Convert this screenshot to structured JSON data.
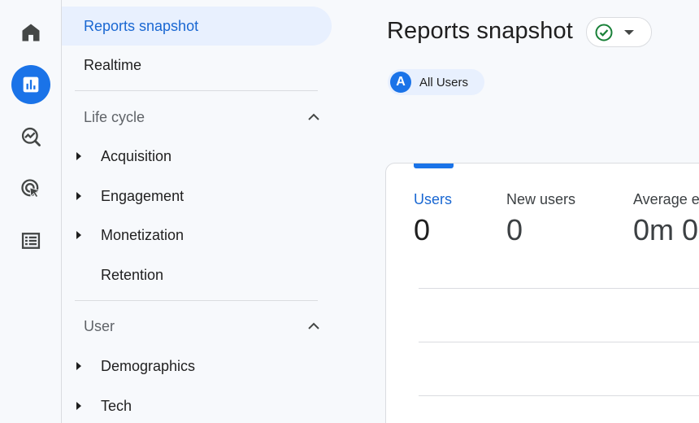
{
  "nav": {
    "top_items": [
      {
        "label": "Reports snapshot",
        "selected": true
      },
      {
        "label": "Realtime",
        "selected": false
      }
    ],
    "sections": [
      {
        "title": "Life cycle",
        "expanded": true,
        "items": [
          {
            "label": "Acquisition",
            "has_children": true
          },
          {
            "label": "Engagement",
            "has_children": true
          },
          {
            "label": "Monetization",
            "has_children": true
          },
          {
            "label": "Retention",
            "has_children": false
          }
        ]
      },
      {
        "title": "User",
        "expanded": true,
        "items": [
          {
            "label": "Demographics",
            "has_children": true
          },
          {
            "label": "Tech",
            "has_children": true
          }
        ]
      }
    ]
  },
  "rail": {
    "items": [
      {
        "icon": "home-icon",
        "active": false
      },
      {
        "icon": "reports-icon",
        "active": true
      },
      {
        "icon": "explore-icon",
        "active": false
      },
      {
        "icon": "advertising-icon",
        "active": false
      },
      {
        "icon": "configure-icon",
        "active": false
      }
    ]
  },
  "main": {
    "title": "Reports snapshot",
    "status_icon": "check-circle-icon",
    "segment": {
      "avatar_letter": "A",
      "label": "All Users"
    },
    "metrics": [
      {
        "label": "Users",
        "value": "0",
        "active": true
      },
      {
        "label": "New users",
        "value": "0",
        "active": false
      },
      {
        "label": "Average e",
        "value": "0m 0",
        "active": false
      }
    ]
  },
  "colors": {
    "accent": "#1a73e8",
    "selected_bg": "#e8f0fe",
    "selected_text": "#1967d2",
    "status_green": "#188038"
  }
}
